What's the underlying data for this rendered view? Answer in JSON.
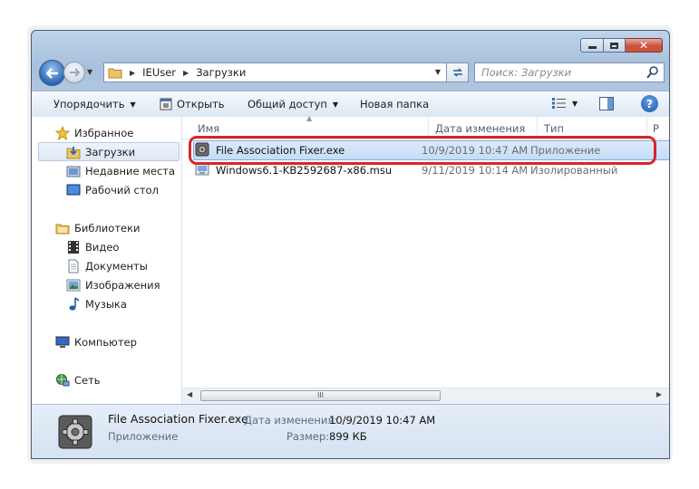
{
  "window": {
    "minimize": "minimize",
    "maximize": "maximize",
    "close": "close"
  },
  "address": {
    "crumbs": [
      "IEUser",
      "Загрузки"
    ]
  },
  "search": {
    "placeholder": "Поиск: Загрузки"
  },
  "toolbar": {
    "organize": "Упорядочить",
    "open": "Открыть",
    "share": "Общий доступ",
    "new_folder": "Новая папка",
    "help": "?"
  },
  "sidebar": {
    "favorites": "Избранное",
    "downloads": "Загрузки",
    "recent": "Недавние места",
    "desktop": "Рабочий стол",
    "libraries": "Библиотеки",
    "video": "Видео",
    "documents": "Документы",
    "images": "Изображения",
    "music": "Музыка",
    "computer": "Компьютер",
    "network": "Сеть"
  },
  "columns": {
    "name": "Имя",
    "date": "Дата изменения",
    "type": "Тип",
    "size": "Р"
  },
  "files": [
    {
      "name": "File Association Fixer.exe",
      "date": "10/9/2019 10:47 AM",
      "type": "Приложение",
      "selected": true
    },
    {
      "name": "Windows6.1-KB2592687-x86.msu",
      "date": "9/11/2019 10:14 AM",
      "type": "Изолированный",
      "selected": false
    }
  ],
  "scrollbar": {
    "grip": "III"
  },
  "details": {
    "name": "File Association Fixer.exe",
    "type": "Приложение",
    "date_label": "Дата изменения:",
    "date_value": "10/9/2019 10:47 AM",
    "size_label": "Размер:",
    "size_value": "899 КБ"
  },
  "colors": {
    "selection_border": "#84acdd",
    "highlight_red": "#d7262a",
    "window_frame": "#b9cde6"
  }
}
